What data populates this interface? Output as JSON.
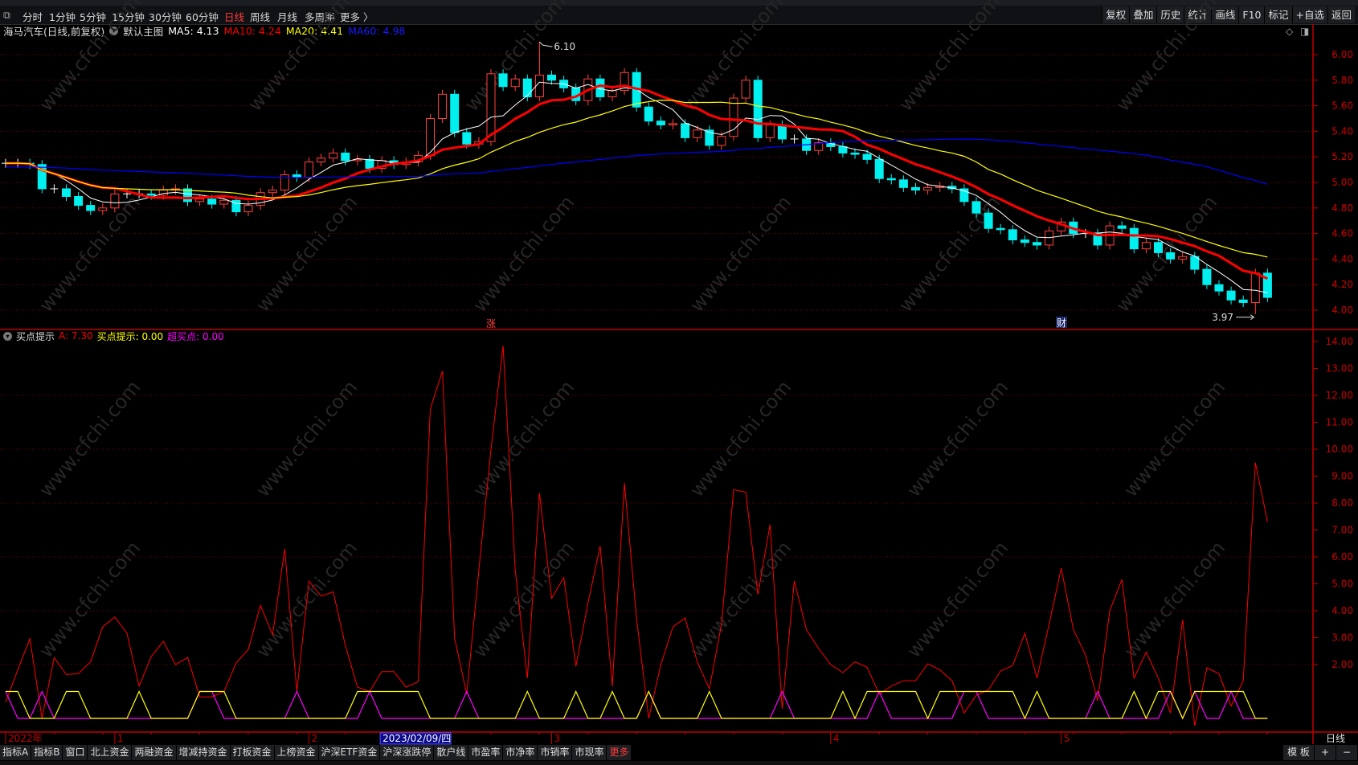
{
  "toolbar": {
    "periods": [
      "分时",
      "1分钟",
      "5分钟",
      "15分钟",
      "30分钟",
      "60分钟",
      "日线",
      "周线",
      "月线",
      "多周期",
      "更多 〉"
    ],
    "active_period_index": 6,
    "right_buttons": [
      "复权",
      "叠加",
      "历史",
      "统计",
      "画线",
      "F10",
      "标记",
      "+自选",
      "返回"
    ]
  },
  "main_header": {
    "title": "海马汽车(日线,前复权)",
    "template": "默认主图",
    "ma5": "MA5: 4.13",
    "ma10": "MA10: 4.24",
    "ma20": "MA20: 4.41",
    "ma60": "MA60: 4.98"
  },
  "indicator_header": {
    "name": "买点提示",
    "a": "A: 7.30",
    "buy_hint": "买点提示: 0.00",
    "super_buy": "超买点: 0.00"
  },
  "annotations": {
    "high_label": "6.10",
    "low_label": "3.97",
    "marker_zhang": "涨",
    "marker_cai": "财"
  },
  "time_axis": {
    "labels": [
      {
        "text": "2022年",
        "idx": 0
      },
      {
        "text": "1",
        "idx": 9
      },
      {
        "text": "2",
        "idx": 25
      },
      {
        "text": "3",
        "idx": 45
      },
      {
        "text": "4",
        "idx": 68
      },
      {
        "text": "5",
        "idx": 87
      }
    ],
    "cursor_date": "2023/02/09/四",
    "cursor_idx": 31,
    "period_label": "日线"
  },
  "bottom_tabs": [
    "指标A",
    "指标B",
    "窗口",
    "北上资金",
    "两融资金",
    "增减持资金",
    "打板资金",
    "上榜资金",
    "沪深ETF资金",
    "沪深涨跌停",
    "散户线",
    "市盈率",
    "市净率",
    "市销率",
    "市现率",
    "更多"
  ],
  "bottom_right": {
    "template_label": "模 板",
    "plus": "+",
    "minus": "−"
  },
  "watermark": "www.cfchi.com",
  "colors": {
    "up": "#ff4040",
    "down": "#00f0f0",
    "ma5": "#ffffff",
    "ma10": "#ff0000",
    "ma20": "#ffff00",
    "ma60": "#0000ff",
    "axis": "#c00000"
  },
  "chart_data": [
    {
      "type": "candlestick",
      "title": "海马汽车(日线,前复权)",
      "ylim": [
        4.0,
        6.0
      ],
      "yticks": [
        "4.00",
        "4.20",
        "4.40",
        "4.60",
        "4.80",
        "5.00",
        "5.20",
        "5.40",
        "5.60",
        "5.80",
        "6.00"
      ],
      "close": [
        5.15,
        5.15,
        5.14,
        4.95,
        4.95,
        4.89,
        4.82,
        4.78,
        4.8,
        4.91,
        4.91,
        4.91,
        4.9,
        4.94,
        4.95,
        4.85,
        4.87,
        4.83,
        4.86,
        4.77,
        4.82,
        4.92,
        4.94,
        5.06,
        5.04,
        5.16,
        5.19,
        5.23,
        5.17,
        5.18,
        5.11,
        5.17,
        5.14,
        5.16,
        5.21,
        5.5,
        5.69,
        5.39,
        5.3,
        5.32,
        5.85,
        5.75,
        5.81,
        5.67,
        5.84,
        5.8,
        5.74,
        5.64,
        5.81,
        5.67,
        5.72,
        5.86,
        5.59,
        5.48,
        5.45,
        5.46,
        5.35,
        5.41,
        5.29,
        5.36,
        5.66,
        5.8,
        5.35,
        5.45,
        5.34,
        5.34,
        5.25,
        5.31,
        5.28,
        5.23,
        5.22,
        5.18,
        5.03,
        5.02,
        4.96,
        4.94,
        4.96,
        4.97,
        4.95,
        4.85,
        4.76,
        4.64,
        4.63,
        4.55,
        4.53,
        4.51,
        4.62,
        4.69,
        4.6,
        4.6,
        4.51,
        4.66,
        4.64,
        4.48,
        4.53,
        4.45,
        4.4,
        4.42,
        4.32,
        4.2,
        4.15,
        4.08,
        4.06,
        4.29,
        4.1
      ],
      "extreme_high": {
        "idx": 44,
        "value": 6.1
      },
      "extreme_low": {
        "idx": 103,
        "value": 3.97
      },
      "ma_periods": [
        5,
        10,
        20,
        60
      ]
    },
    {
      "type": "line",
      "title": "买点提示",
      "ylim": [
        0,
        14.5
      ],
      "yticks": [
        "2.00",
        "3.00",
        "4.00",
        "5.00",
        "6.00",
        "7.00",
        "8.00",
        "9.00",
        "10.00",
        "11.00",
        "12.00",
        "13.00",
        "14.00"
      ],
      "series": [
        {
          "name": "A",
          "color": "#ff0000",
          "values": [
            0.6,
            1.8,
            2.96,
            0.0,
            2.26,
            1.63,
            1.66,
            2.1,
            3.4,
            3.76,
            3.16,
            1.2,
            2.3,
            2.86,
            2.0,
            2.26,
            0.8,
            0.8,
            1.0,
            2.06,
            2.56,
            4.2,
            3.1,
            6.3,
            1.0,
            5.1,
            4.54,
            4.7,
            2.7,
            1.16,
            1.0,
            1.74,
            1.74,
            1.16,
            1.36,
            11.5,
            12.9,
            3.0,
            0.9,
            5.5,
            10.0,
            13.84,
            5.5,
            1.5,
            8.36,
            4.46,
            5.23,
            1.93,
            4.3,
            6.4,
            1.2,
            8.74,
            3.7,
            0.0,
            2.0,
            3.4,
            3.73,
            2.1,
            1.1,
            3.5,
            8.5,
            8.4,
            4.6,
            7.2,
            0.36,
            5.1,
            3.3,
            2.6,
            2.0,
            1.7,
            2.1,
            1.9,
            0.9,
            1.2,
            1.4,
            1.4,
            2.03,
            1.8,
            1.4,
            0.2,
            0.86,
            1.06,
            1.76,
            1.96,
            3.16,
            1.5,
            3.5,
            5.58,
            3.3,
            2.36,
            0.66,
            4.0,
            5.16,
            1.5,
            2.46,
            1.5,
            0.2,
            3.66,
            -0.27,
            1.88,
            1.66,
            0.46,
            1.4,
            9.5,
            7.3
          ]
        },
        {
          "name": "买点提示",
          "color": "#ffff00",
          "high_idx": [
            0,
            1,
            5,
            6,
            11,
            16,
            17,
            18,
            29,
            30,
            31,
            32,
            33,
            34,
            43,
            47,
            50,
            53,
            58,
            69,
            71,
            72,
            73,
            74,
            75,
            77,
            78,
            79,
            80,
            81,
            82,
            83,
            85,
            93,
            95,
            96,
            98,
            99,
            100,
            101,
            102
          ]
        },
        {
          "name": "超买点",
          "color": "#ff00ff",
          "high_idx": [
            0,
            3,
            16,
            17,
            24,
            30,
            38,
            53,
            64,
            72,
            79,
            80,
            90,
            96,
            98,
            101
          ]
        }
      ]
    }
  ]
}
